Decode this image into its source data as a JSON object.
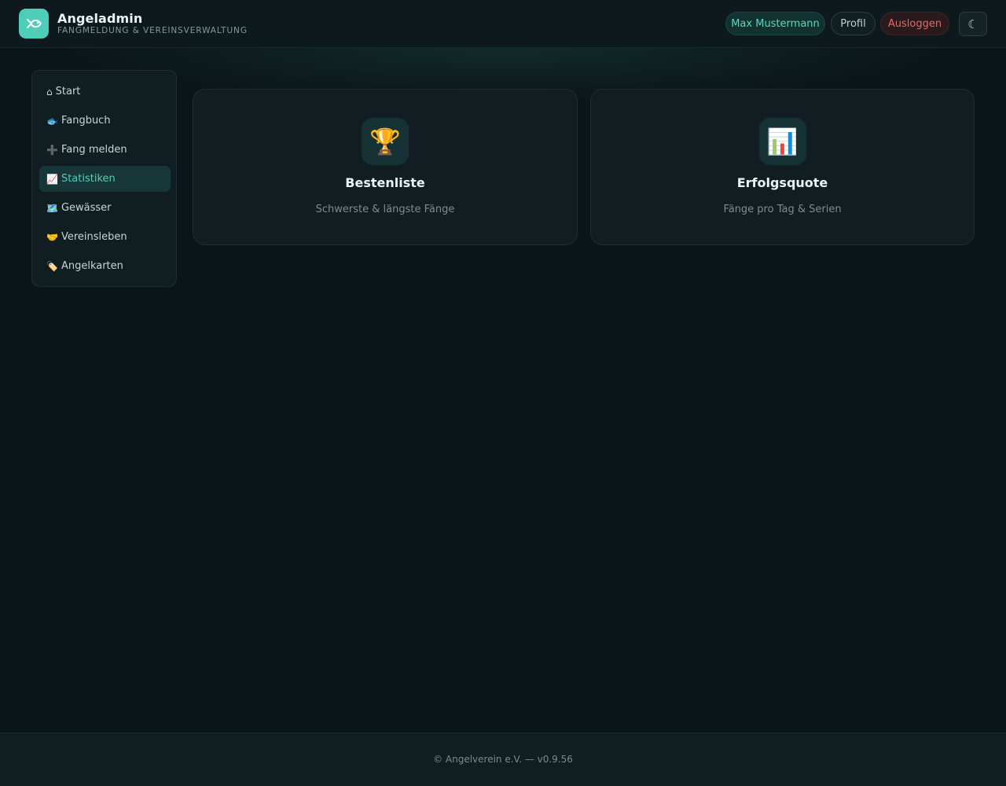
{
  "brand": {
    "title": "Angeladmin",
    "subtitle": "FANGMELDUNG & VEREINSVERWALTUNG",
    "logo_icon": "fish-icon",
    "accent": "#4ecdb8"
  },
  "header": {
    "user_name": "Max Mustermann",
    "profile_label": "Profil",
    "logout_label": "Ausloggen",
    "theme_toggle_glyph": "☾"
  },
  "sidebar": {
    "items": [
      {
        "icon": "⌂",
        "label": "Start",
        "active": false
      },
      {
        "icon": "🐟",
        "label": "Fangbuch",
        "active": false
      },
      {
        "icon": "➕",
        "label": "Fang melden",
        "active": false
      },
      {
        "icon": "📈",
        "label": "Statistiken",
        "active": true
      },
      {
        "icon": "🗺️",
        "label": "Gewässer",
        "active": false
      },
      {
        "icon": "🤝",
        "label": "Vereinsleben",
        "active": false
      },
      {
        "icon": "🏷️",
        "label": "Angelkarten",
        "active": false
      }
    ]
  },
  "cards": [
    {
      "icon": "🏆",
      "title": "Bestenliste",
      "subtitle": "Schwerste & längste Fänge"
    },
    {
      "icon": "📊",
      "title": "Erfolgsquote",
      "subtitle": "Fänge pro Tag & Serien"
    }
  ],
  "footer": {
    "text": "© Angelverein e.V. — v0.9.56"
  }
}
